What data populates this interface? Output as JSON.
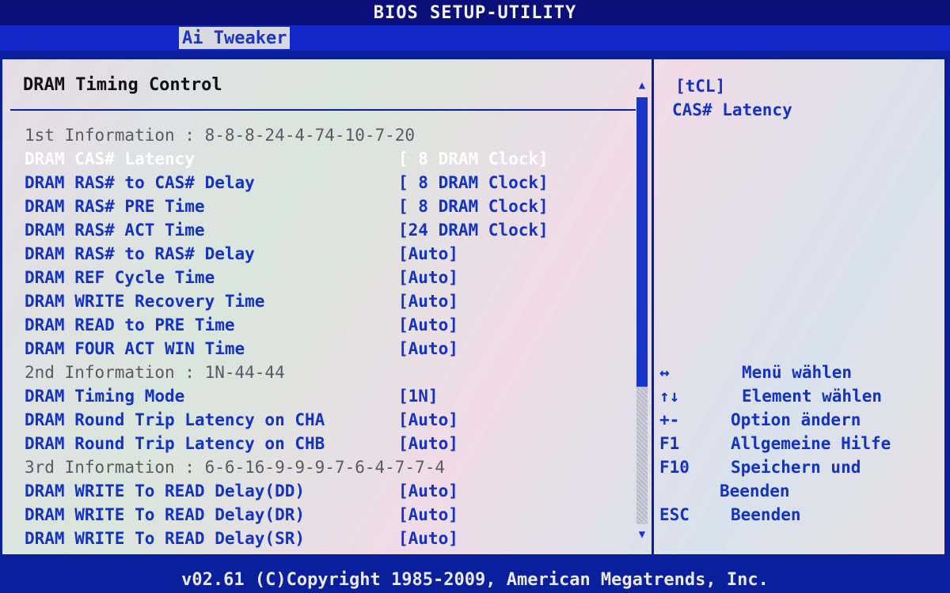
{
  "title": "BIOS SETUP-UTILITY",
  "menu": {
    "active_tab": "Ai Tweaker"
  },
  "section_title": "DRAM Timing Control",
  "rows": [
    {
      "type": "info",
      "label": "1st Information : 8-8-8-24-4-74-10-7-20",
      "value": ""
    },
    {
      "type": "selected",
      "label": "DRAM CAS# Latency",
      "value": "[ 8 DRAM Clock]"
    },
    {
      "type": "item",
      "label": "DRAM RAS# to CAS# Delay",
      "value": "[ 8 DRAM Clock]"
    },
    {
      "type": "item",
      "label": "DRAM RAS# PRE Time",
      "value": "[ 8 DRAM Clock]"
    },
    {
      "type": "item",
      "label": "DRAM RAS# ACT Time",
      "value": "[24 DRAM Clock]"
    },
    {
      "type": "item",
      "label": "DRAM RAS# to RAS# Delay",
      "value": "[Auto]"
    },
    {
      "type": "item",
      "label": "DRAM REF Cycle Time",
      "value": "[Auto]"
    },
    {
      "type": "item",
      "label": "DRAM WRITE Recovery Time",
      "value": "[Auto]"
    },
    {
      "type": "item",
      "label": "DRAM READ to PRE Time",
      "value": "[Auto]"
    },
    {
      "type": "item",
      "label": "DRAM FOUR ACT WIN Time",
      "value": "[Auto]"
    },
    {
      "type": "info",
      "label": "2nd Information : 1N-44-44",
      "value": ""
    },
    {
      "type": "item",
      "label": "DRAM Timing Mode",
      "value": "[1N]"
    },
    {
      "type": "item",
      "label": "DRAM Round Trip Latency on CHA",
      "value": "[Auto]"
    },
    {
      "type": "item",
      "label": "DRAM Round Trip Latency on CHB",
      "value": "[Auto]"
    },
    {
      "type": "info",
      "label": "3rd Information : 6-6-16-9-9-9-7-6-4-7-7-4",
      "value": ""
    },
    {
      "type": "item",
      "label": "DRAM WRITE To READ Delay(DD)",
      "value": "[Auto]"
    },
    {
      "type": "item",
      "label": "DRAM WRITE To READ Delay(DR)",
      "value": "[Auto]"
    },
    {
      "type": "item",
      "label": "DRAM WRITE To READ Delay(SR)",
      "value": "[Auto]"
    }
  ],
  "help": {
    "title": "[tCL]",
    "description": "CAS# Latency"
  },
  "keys": [
    {
      "key": "↔",
      "desc": "Menü wählen"
    },
    {
      "key": "↑↓",
      "desc": "Element wählen"
    },
    {
      "key": "+-",
      "desc": "Option ändern"
    },
    {
      "key": "F1",
      "desc": "Allgemeine Hilfe"
    },
    {
      "key": "F10",
      "desc": "Speichern und"
    },
    {
      "key": "",
      "desc": "Beenden"
    },
    {
      "key": "ESC",
      "desc": "Beenden"
    }
  ],
  "footer": "v02.61 (C)Copyright 1985-2009, American Megatrends, Inc.",
  "colors": {
    "background": "#0a1f9c",
    "item_text": "#1432c4",
    "selected_text": "#ffffff",
    "info_text": "#5a5a66"
  }
}
